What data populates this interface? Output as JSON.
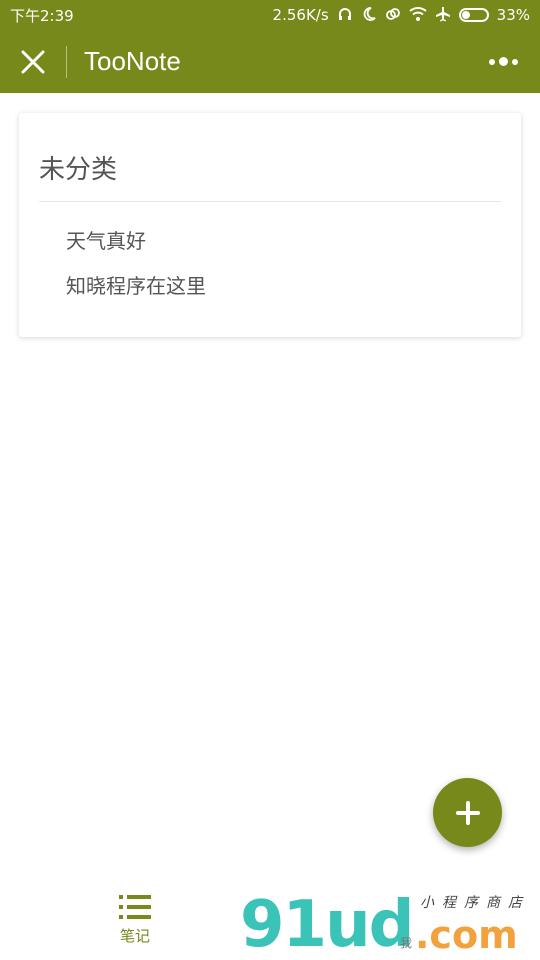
{
  "status_bar": {
    "time": "下午2:39",
    "network_speed": "2.56K/s",
    "battery": "33%",
    "battery_level": 0.33,
    "icons": [
      "headphones-icon",
      "moon-icon",
      "sync-icon",
      "wifi-icon",
      "airplane-icon",
      "battery-icon"
    ]
  },
  "navbar": {
    "title": "TooNote",
    "background": "#76891a"
  },
  "category": {
    "title": "未分类",
    "notes": [
      "天气真好",
      "知晓程序在这里"
    ]
  },
  "fab": {
    "icon": "plus-icon",
    "label": "+"
  },
  "tab_bar": {
    "tabs": [
      {
        "label": "笔记",
        "icon": "list-icon",
        "active": true
      }
    ]
  },
  "watermark": {
    "logo": "91ud",
    "domain": ".com",
    "slogan": "小程序商店",
    "small": "我"
  }
}
